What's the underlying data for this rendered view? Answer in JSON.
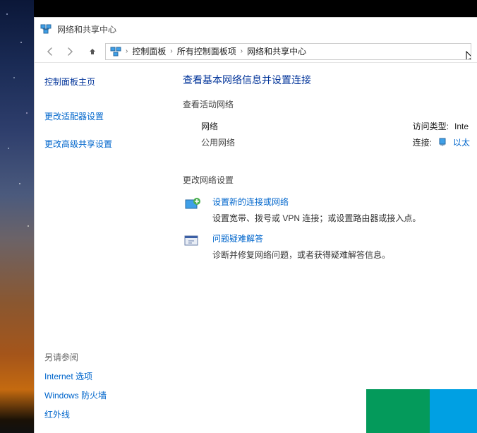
{
  "window": {
    "title": "网络和共享中心"
  },
  "breadcrumb": {
    "items": [
      "控制面板",
      "所有控制面板项",
      "网络和共享中心"
    ]
  },
  "sidebar": {
    "home": "控制面板主页",
    "links": [
      "更改适配器设置",
      "更改高级共享设置"
    ],
    "seealso_head": "另请参阅",
    "seealso": [
      "Internet 选项",
      "Windows 防火墙",
      "红外线"
    ]
  },
  "main": {
    "heading": "查看基本网络信息并设置连接",
    "active_label": "查看活动网络",
    "network": {
      "name": "网络",
      "type": "公用网络",
      "access_label": "访问类型:",
      "access_value": "Inte",
      "conn_label": "连接:",
      "conn_value": "以太"
    },
    "change_label": "更改网络设置",
    "opt1": {
      "title": "设置新的连接或网络",
      "desc": "设置宽带、拨号或 VPN 连接；或设置路由器或接入点。"
    },
    "opt2": {
      "title": "问题疑难解答",
      "desc": "诊断并修复网络问题，或者获得疑难解答信息。"
    }
  },
  "colors": {
    "sq1": "#049a5b",
    "sq2": "#00a0e3",
    "sq3": "#f39b12",
    "sq4": "#009e60"
  }
}
